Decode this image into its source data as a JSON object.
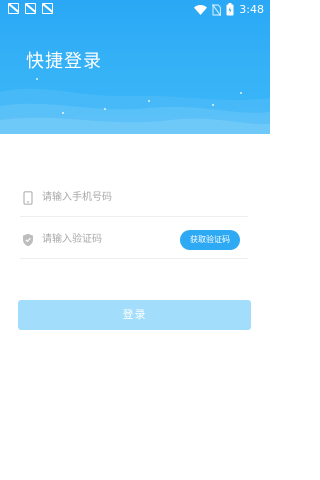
{
  "status_bar": {
    "time": "3:48",
    "left_icons": [
      "notification-icon",
      "notification-icon",
      "notification-icon"
    ],
    "right_icons": [
      "wifi-icon",
      "no-sim-icon",
      "battery-icon"
    ]
  },
  "header": {
    "title": "快捷登录"
  },
  "form": {
    "phone": {
      "placeholder": "请输入手机号码",
      "value": "",
      "icon": "phone-icon"
    },
    "code": {
      "placeholder": "请输入验证码",
      "value": "",
      "icon": "shield-icon",
      "button_label": "获取验证码"
    },
    "login_label": "登录"
  },
  "colors": {
    "header_blue": "#2aa8f5",
    "code_button": "#2ea9f4",
    "login_button_disabled": "#a2ddfb"
  }
}
